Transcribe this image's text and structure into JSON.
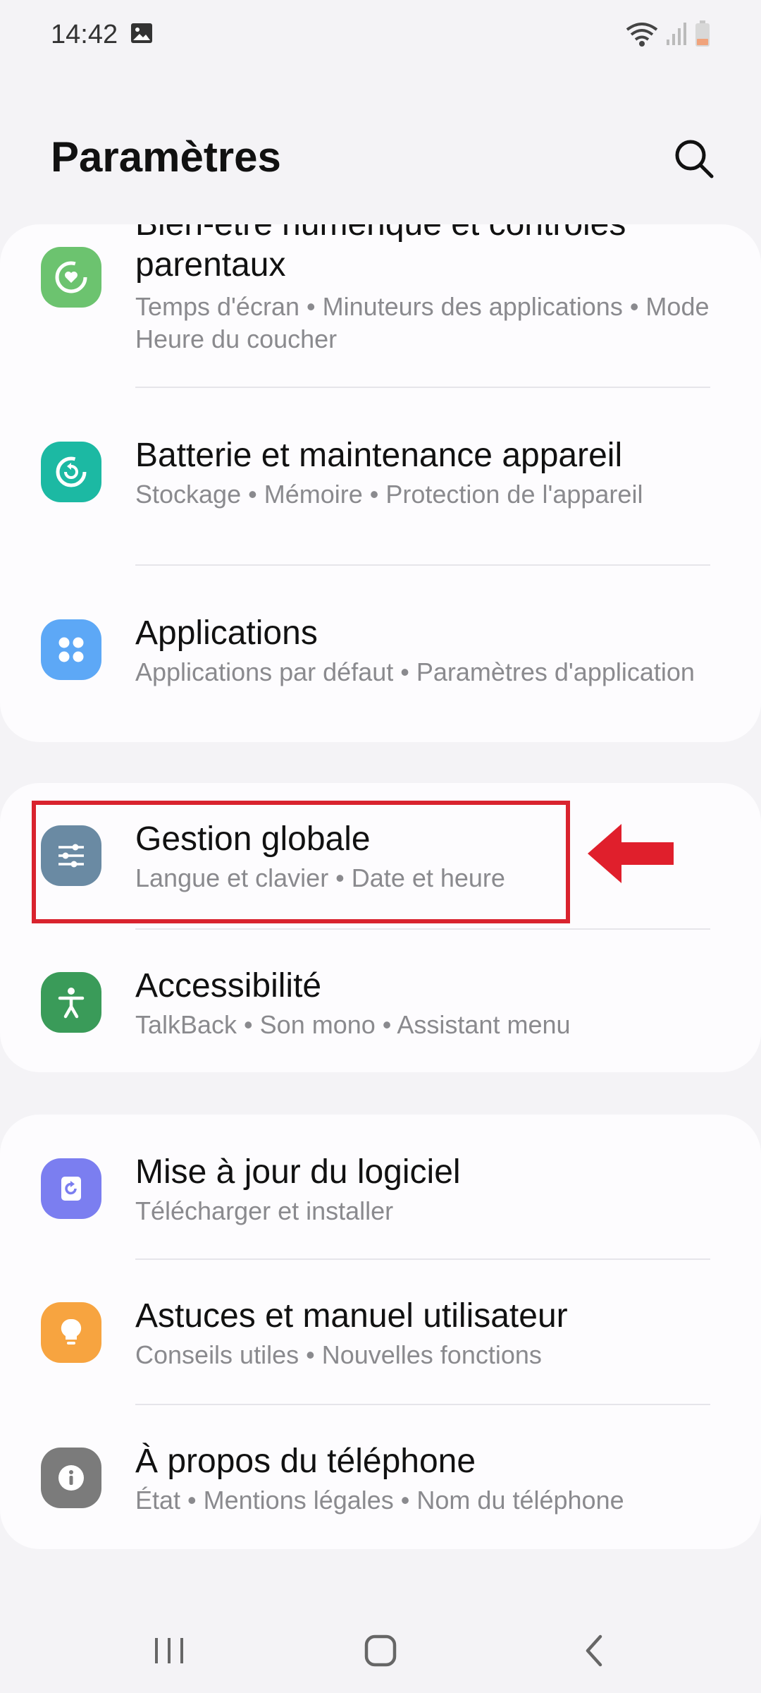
{
  "status_bar": {
    "time": "14:42"
  },
  "header": {
    "title": "Paramètres"
  },
  "groups": [
    {
      "items": [
        {
          "title_lines": [
            "Bien-être numérique et contrôles",
            "parentaux"
          ],
          "subtitle": "Temps d'écran • Minuteurs des applications • Mode Heure du coucher",
          "icon": "digital-wellbeing-icon",
          "icon_color": "#6cc36f"
        },
        {
          "title": "Batterie et maintenance appareil",
          "subtitle": "Stockage • Mémoire • Protection de l'appareil",
          "icon": "battery-care-icon",
          "icon_color": "#1cb9a3"
        },
        {
          "title": "Applications",
          "subtitle": "Applications par défaut • Paramètres d'application",
          "icon": "apps-icon",
          "icon_color": "#5da8f6"
        }
      ]
    },
    {
      "items": [
        {
          "title": "Gestion globale",
          "subtitle": "Langue et clavier • Date et heure",
          "icon": "sliders-icon",
          "icon_color": "#6a8aa3"
        },
        {
          "title": "Accessibilité",
          "subtitle": "TalkBack • Son mono • Assistant menu",
          "icon": "accessibility-icon",
          "icon_color": "#3a9b59"
        }
      ]
    },
    {
      "items": [
        {
          "title": "Mise à jour du logiciel",
          "subtitle": "Télécharger et installer",
          "icon": "software-update-icon",
          "icon_color": "#7b7ef0"
        },
        {
          "title": "Astuces et manuel utilisateur",
          "subtitle": "Conseils utiles • Nouvelles fonctions",
          "icon": "lightbulb-icon",
          "icon_color": "#f7a440"
        },
        {
          "title": "À propos du téléphone",
          "subtitle": "État • Mentions légales • Nom du téléphone",
          "icon": "info-icon",
          "icon_color": "#7b7b7b"
        }
      ]
    }
  ],
  "annotation": {
    "highlight_color": "#d9232e"
  }
}
